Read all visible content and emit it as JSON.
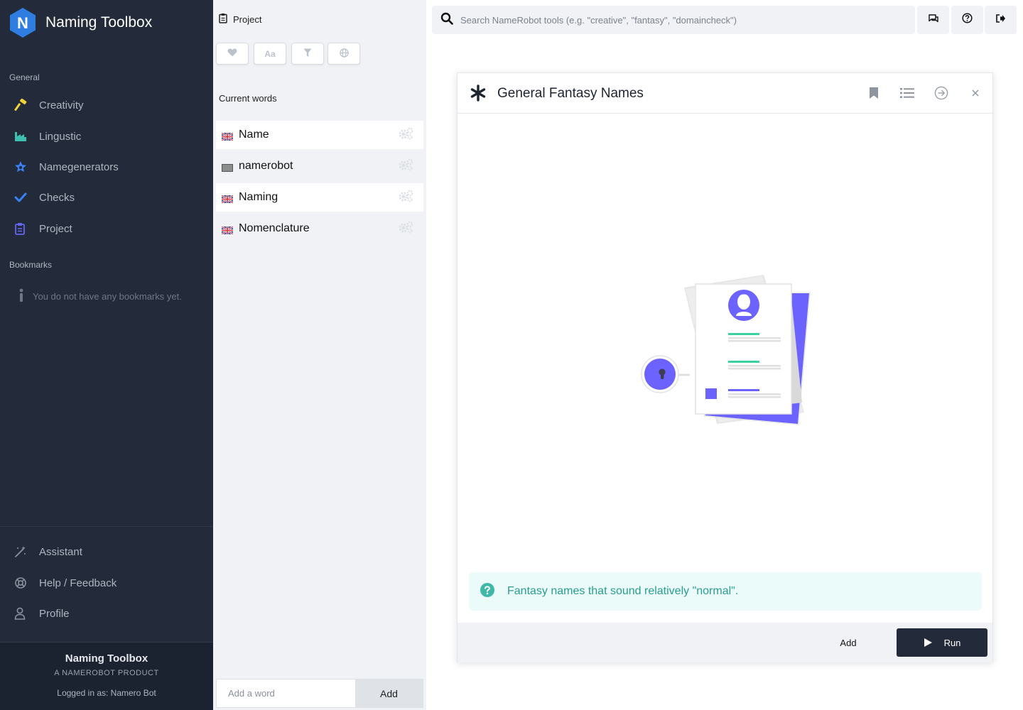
{
  "app": {
    "brand_letter": "N",
    "title": "Naming Toolbox"
  },
  "sidebar": {
    "general_label": "General",
    "nav": [
      {
        "label": "Creativity",
        "icon": "hammer-icon",
        "color": "#f5d33b"
      },
      {
        "label": "Lingustic",
        "icon": "factory-icon",
        "color": "#3fbfb0"
      },
      {
        "label": "Namegenerators",
        "icon": "star-gear-icon",
        "color": "#3b82f6"
      },
      {
        "label": "Checks",
        "icon": "check-icon",
        "color": "#3b82f6"
      },
      {
        "label": "Project",
        "icon": "clipboard-icon",
        "color": "#6366f1"
      }
    ],
    "bookmarks_label": "Bookmarks",
    "bookmarks_empty": "You do not have any bookmarks yet.",
    "bottom_nav": [
      {
        "label": "Assistant",
        "icon": "magic-wand-icon"
      },
      {
        "label": "Help / Feedback",
        "icon": "lifebuoy-icon"
      },
      {
        "label": "Profile",
        "icon": "user-icon"
      }
    ],
    "footer": {
      "title": "Naming Toolbox",
      "subtitle": "A NAMEROBOT PRODUCT",
      "logged_in": "Logged in as: Namero Bot"
    }
  },
  "project": {
    "title": "Project",
    "toolbar": [
      {
        "icon": "heart-icon"
      },
      {
        "icon": "font-case-icon",
        "text": "Aa"
      },
      {
        "icon": "filter-icon"
      },
      {
        "icon": "globe-icon"
      }
    ],
    "current_words_label": "Current words",
    "words": [
      {
        "word": "Name",
        "flag": "uk-flag-icon",
        "highlighted": true
      },
      {
        "word": "namerobot",
        "flag": "neutral-flag-icon",
        "highlighted": false
      },
      {
        "word": "Naming",
        "flag": "uk-flag-icon",
        "highlighted": true
      },
      {
        "word": "Nomenclature",
        "flag": "uk-flag-icon",
        "highlighted": false
      }
    ],
    "add_word_placeholder": "Add a word",
    "add_word_button": "Add"
  },
  "topbar": {
    "search_placeholder": "Search NameRobot tools (e.g. \"creative\", \"fantasy\", \"domaincheck\")",
    "buttons": [
      "chat-icon",
      "help-icon",
      "logout-icon"
    ]
  },
  "tool": {
    "title": "General Fantasy Names",
    "description": "Fantasy names that sound relatively \"normal\".",
    "add_label": "Add",
    "run_label": "Run",
    "accent_color": "#6c63ff",
    "info_color": "#2a9d8f"
  }
}
